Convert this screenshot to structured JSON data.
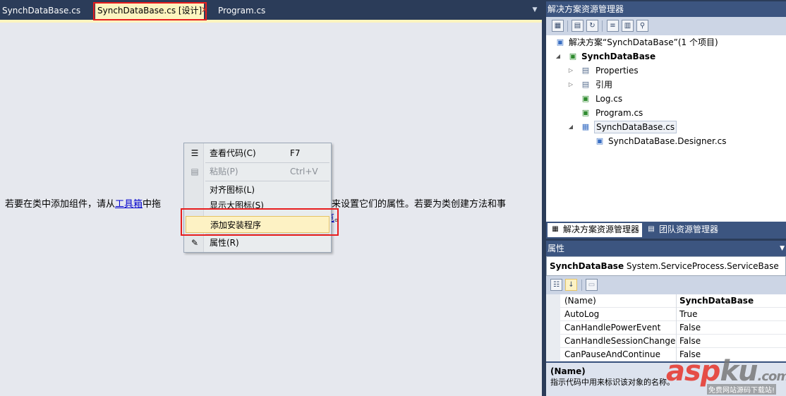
{
  "editor": {
    "tabs": [
      {
        "label": "SynchDataBase.cs"
      },
      {
        "label": "SynchDataBase.cs [设计]"
      },
      {
        "label": "Program.cs"
      }
    ],
    "hint_before": "若要在类中添加组件，请从",
    "hint_link": "工具箱",
    "hint_middle": "中拖",
    "hint_after": "来设置它们的属性。若要为类创建方法和事",
    "hint_tail_link": "览",
    "hint_tail": "。"
  },
  "context_menu": {
    "items": [
      {
        "label": "查看代码(C)",
        "shortcut": "F7",
        "icon": "view-code-icon"
      },
      {
        "label": "粘贴(P)",
        "shortcut": "Ctrl+V",
        "icon": "paste-icon"
      },
      {
        "label": "对齐图标(L)",
        "shortcut": ""
      },
      {
        "label": "显示大图标(S)",
        "shortcut": ""
      },
      {
        "label": "添加安装程序",
        "shortcut": ""
      },
      {
        "label": "属性(R)",
        "shortcut": "",
        "icon": "properties-icon"
      }
    ]
  },
  "solution_explorer": {
    "title": "解决方案资源管理器",
    "tree": [
      {
        "label": "解决方案“SynchDataBase”(1 个项目)"
      },
      {
        "label": "SynchDataBase"
      },
      {
        "label": "Properties"
      },
      {
        "label": "引用"
      },
      {
        "label": "Log.cs"
      },
      {
        "label": "Program.cs"
      },
      {
        "label": "SynchDataBase.cs"
      },
      {
        "label": "SynchDataBase.Designer.cs"
      }
    ],
    "tabs": [
      {
        "label": "解决方案资源管理器"
      },
      {
        "label": "团队资源管理器"
      }
    ]
  },
  "properties": {
    "title": "属性",
    "object_name": "SynchDataBase",
    "object_type": "System.ServiceProcess.ServiceBase",
    "rows": [
      {
        "name": "(Name)",
        "value": "SynchDataBase"
      },
      {
        "name": "AutoLog",
        "value": "True"
      },
      {
        "name": "CanHandlePowerEvent",
        "value": "False"
      },
      {
        "name": "CanHandleSessionChangeEvent",
        "value": "False"
      },
      {
        "name": "CanPauseAndContinue",
        "value": "False"
      }
    ],
    "desc_title": "(Name)",
    "desc_text": "指示代码中用来标识该对象的名称。"
  },
  "watermark": {
    "text_asp": "asp",
    "text_ku": "ku",
    "text_com": ".com",
    "subtitle": "免费网站源码下载站!"
  },
  "colors": {
    "highlight_box": "#e81e1e",
    "active_tab": "#fdf4bf",
    "panel_header": "#3c5580"
  }
}
